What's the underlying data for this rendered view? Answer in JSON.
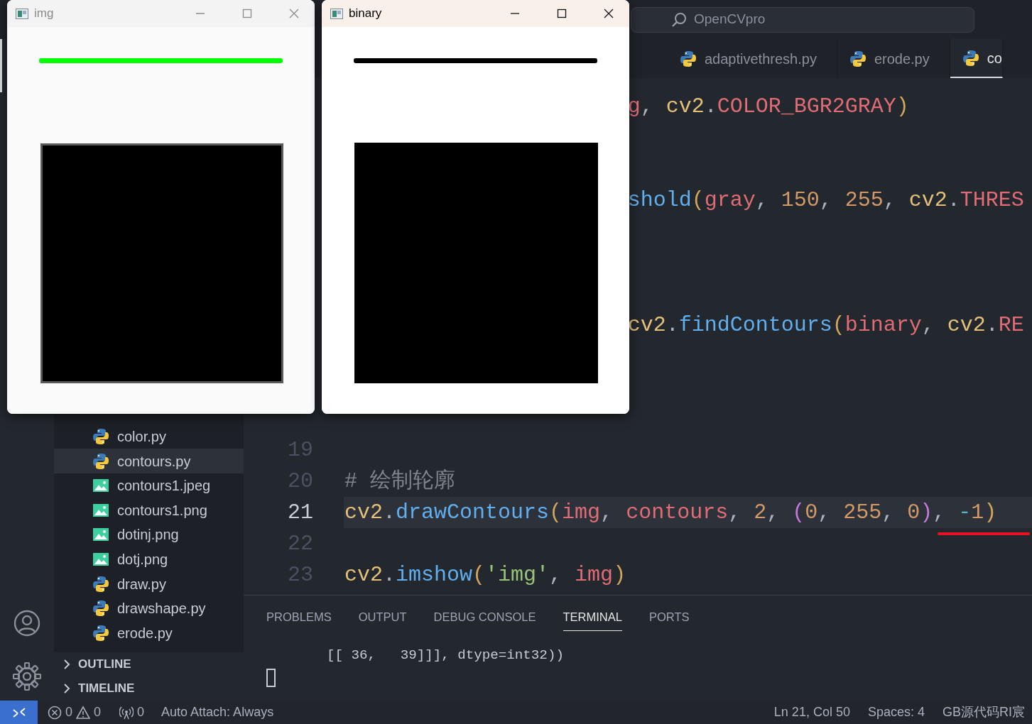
{
  "title_bar": {
    "search": {
      "placeholder": "OpenCVpro"
    }
  },
  "activity_bar": {
    "explorer_selected": true
  },
  "explorer": {
    "items": [
      {
        "name": "color.py",
        "kind": "python",
        "selected": false
      },
      {
        "name": "contours.py",
        "kind": "python",
        "selected": true
      },
      {
        "name": "contours1.jpeg",
        "kind": "image",
        "selected": false
      },
      {
        "name": "contours1.png",
        "kind": "image",
        "selected": false
      },
      {
        "name": "dotinj.png",
        "kind": "image",
        "selected": false
      },
      {
        "name": "dotj.png",
        "kind": "image",
        "selected": false
      },
      {
        "name": "draw.py",
        "kind": "python",
        "selected": false
      },
      {
        "name": "drawshape.py",
        "kind": "python",
        "selected": false
      },
      {
        "name": "erode.py",
        "kind": "python",
        "selected": false
      }
    ],
    "sections": [
      {
        "label": "OUTLINE",
        "expanded": false
      },
      {
        "label": "TIMELINE",
        "expanded": false
      }
    ]
  },
  "tabs": [
    {
      "label": "adaptivethresh.py",
      "selected": false
    },
    {
      "label": "erode.py",
      "selected": false
    },
    {
      "label": "co",
      "selected": true
    }
  ],
  "code_lines": [
    {
      "kind": "code",
      "clipped_left": true,
      "current": false,
      "tokens": [
        {
          "text": "g",
          "kind": "var"
        },
        {
          "text": ", ",
          "kind": "punct"
        },
        {
          "text": "cv2",
          "kind": "module"
        },
        {
          "text": ".",
          "kind": "punct"
        },
        {
          "text": "COLOR_BGR2GRAY",
          "kind": "const"
        },
        {
          "text": ")",
          "kind": "paren"
        }
      ]
    },
    {
      "kind": "blank"
    },
    {
      "kind": "blank"
    },
    {
      "kind": "code",
      "clipped_left": true,
      "current": false,
      "tokens": [
        {
          "text": "shold",
          "kind": "func"
        },
        {
          "text": "(",
          "kind": "paren"
        },
        {
          "text": "gray",
          "kind": "var"
        },
        {
          "text": ", ",
          "kind": "punct"
        },
        {
          "text": "150",
          "kind": "num"
        },
        {
          "text": ", ",
          "kind": "punct"
        },
        {
          "text": "255",
          "kind": "num"
        },
        {
          "text": ", ",
          "kind": "punct"
        },
        {
          "text": "cv2",
          "kind": "module"
        },
        {
          "text": ".",
          "kind": "punct"
        },
        {
          "text": "THRES",
          "kind": "const"
        }
      ]
    },
    {
      "kind": "blank"
    },
    {
      "kind": "blank"
    },
    {
      "kind": "blank"
    },
    {
      "kind": "code",
      "clipped_left": true,
      "current": false,
      "tokens": [
        {
          "text": "cv2",
          "kind": "module"
        },
        {
          "text": ".",
          "kind": "punct"
        },
        {
          "text": "findContours",
          "kind": "func"
        },
        {
          "text": "(",
          "kind": "paren"
        },
        {
          "text": "binary",
          "kind": "var"
        },
        {
          "text": ", ",
          "kind": "punct"
        },
        {
          "text": "cv2",
          "kind": "module"
        },
        {
          "text": ".",
          "kind": "punct"
        },
        {
          "text": "RE",
          "kind": "const"
        }
      ]
    },
    {
      "kind": "blank"
    },
    {
      "kind": "blank"
    },
    {
      "kind": "blank"
    },
    {
      "kind": "code",
      "number": "19",
      "current": false
    },
    {
      "kind": "code",
      "number": "20",
      "clipped_left": false,
      "current": false,
      "tokens": [
        {
          "text": "# 绘制轮廓",
          "kind": "comment"
        }
      ]
    },
    {
      "kind": "code",
      "number": "21",
      "clipped_left": false,
      "current": true,
      "tokens": [
        {
          "text": "cv2",
          "kind": "module"
        },
        {
          "text": ".",
          "kind": "punct"
        },
        {
          "text": "drawContours",
          "kind": "func"
        },
        {
          "text": "(",
          "kind": "paren"
        },
        {
          "text": "img",
          "kind": "var"
        },
        {
          "text": ", ",
          "kind": "punct"
        },
        {
          "text": "contours",
          "kind": "var"
        },
        {
          "text": ", ",
          "kind": "punct"
        },
        {
          "text": "2",
          "kind": "num"
        },
        {
          "text": ", ",
          "kind": "punct"
        },
        {
          "text": "(",
          "kind": "paren2"
        },
        {
          "text": "0",
          "kind": "num"
        },
        {
          "text": ", ",
          "kind": "punct"
        },
        {
          "text": "255",
          "kind": "num"
        },
        {
          "text": ", ",
          "kind": "punct"
        },
        {
          "text": "0",
          "kind": "num"
        },
        {
          "text": ")",
          "kind": "paren2"
        },
        {
          "text": ", ",
          "kind": "punct",
          "underlined": true
        },
        {
          "text": "-",
          "kind": "op",
          "underlined": true
        },
        {
          "text": "1",
          "kind": "num",
          "underlined": true
        },
        {
          "text": ")",
          "kind": "paren",
          "underlined": true
        }
      ]
    },
    {
      "kind": "code",
      "number": "22",
      "current": false
    },
    {
      "kind": "code",
      "number": "23",
      "clipped_left": false,
      "current": false,
      "tokens": [
        {
          "text": "cv2",
          "kind": "module"
        },
        {
          "text": ".",
          "kind": "punct"
        },
        {
          "text": "imshow",
          "kind": "func"
        },
        {
          "text": "(",
          "kind": "paren"
        },
        {
          "text": "'img'",
          "kind": "string"
        },
        {
          "text": ", ",
          "kind": "punct"
        },
        {
          "text": "img",
          "kind": "var"
        },
        {
          "text": ")",
          "kind": "paren"
        }
      ]
    }
  ],
  "panel": {
    "tabs": [
      {
        "label": "PROBLEMS",
        "selected": false
      },
      {
        "label": "OUTPUT",
        "selected": false
      },
      {
        "label": "DEBUG CONSOLE",
        "selected": false
      },
      {
        "label": "TERMINAL",
        "selected": true
      },
      {
        "label": "PORTS",
        "selected": false
      }
    ],
    "terminal_output": "[[ 36,   39]]], dtype=int32))"
  },
  "status_bar": {
    "errors": "0",
    "warnings": "0",
    "ports": "0",
    "auto_attach": "Auto Attach: Always",
    "position": "Ln 21, Col 50",
    "spaces": "Spaces: 4",
    "encoding": "GB源代码RI宸"
  },
  "windows": [
    {
      "title": "img",
      "active": false,
      "color": "#00ff00",
      "kind": "color"
    },
    {
      "title": "binary",
      "active": true,
      "color": "#000000",
      "kind": "binary"
    }
  ]
}
